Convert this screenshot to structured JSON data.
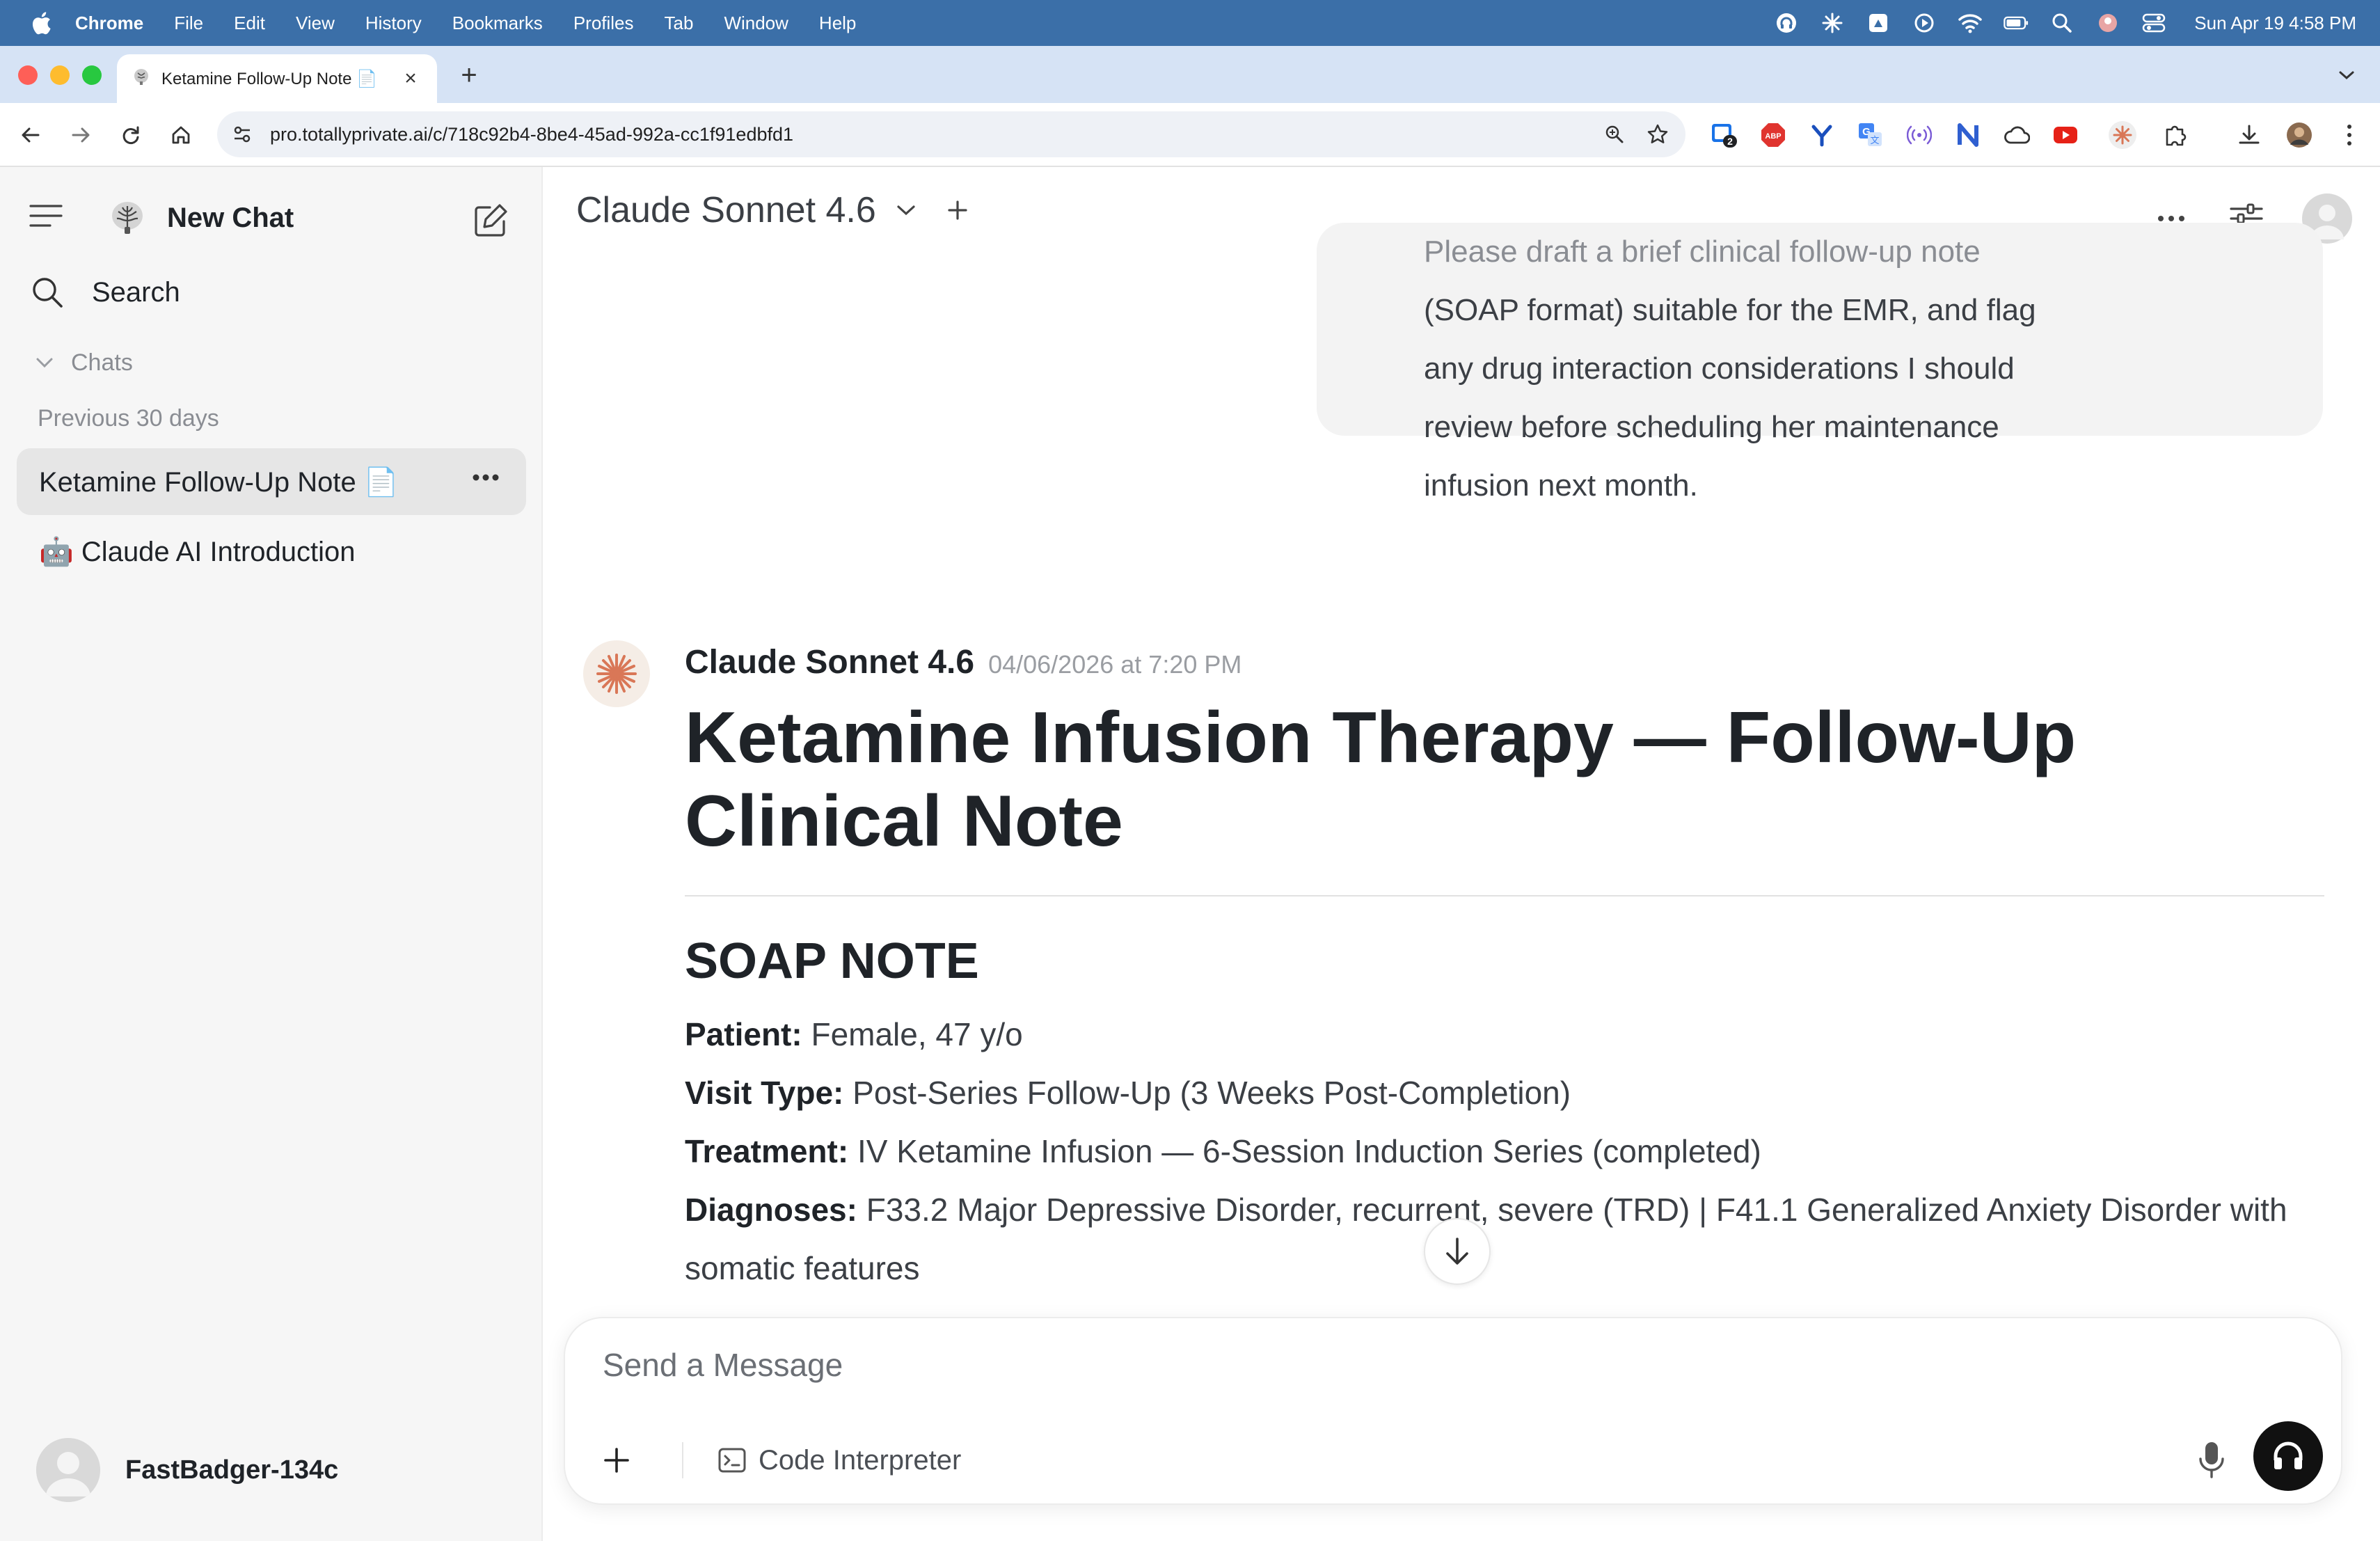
{
  "menubar": {
    "app": "Chrome",
    "items": [
      "File",
      "Edit",
      "View",
      "History",
      "Bookmarks",
      "Profiles",
      "Tab",
      "Window",
      "Help"
    ],
    "clock": "Sun Apr 19  4:58 PM",
    "bg_color": "#3b6fa8"
  },
  "browser": {
    "tab_title": "Ketamine Follow-Up Note 📄",
    "url": "pro.totallyprivate.ai/c/718c92b4-8be4-45ad-992a-cc1f91edbfd1",
    "extension_badge": "2"
  },
  "sidebar": {
    "new_chat_label": "New Chat",
    "search_label": "Search",
    "chats_section_label": "Chats",
    "period_label": "Previous 30 days",
    "chats": [
      {
        "label": "Ketamine Follow-Up Note 📄",
        "active": true
      },
      {
        "label": "🤖 Claude AI Introduction",
        "active": false
      }
    ],
    "user_name": "FastBadger-134c"
  },
  "header": {
    "model_name": "Claude Sonnet 4.6"
  },
  "conversation": {
    "user_message_lines": [
      "Please draft a brief clinical follow-up note",
      "(SOAP format) suitable for the EMR, and flag",
      "any drug interaction considerations I should",
      "review before scheduling her maintenance",
      "infusion next month."
    ],
    "assistant": {
      "name": "Claude Sonnet 4.6",
      "timestamp": "04/06/2026 at 7:20 PM",
      "title": "Ketamine Infusion Therapy — Follow-Up Clinical Note",
      "section_heading": "SOAP NOTE",
      "fields": [
        {
          "label": "Patient:",
          "value": "Female, 47 y/o"
        },
        {
          "label": "Visit Type:",
          "value": "Post-Series Follow-Up (3 Weeks Post-Completion)"
        },
        {
          "label": "Treatment:",
          "value": "IV Ketamine Infusion — 6-Session Induction Series (completed)"
        },
        {
          "label": "Diagnoses:",
          "value": "F33.2 Major Depressive Disorder, recurrent, severe (TRD) | F41.1 Generalized Anxiety Disorder with somatic features"
        }
      ]
    }
  },
  "composer": {
    "placeholder": "Send a Message",
    "code_interpreter_label": "Code Interpreter"
  },
  "colors": {
    "sidebar_bg": "#f6f6f6",
    "active_chat_bg": "#e6e6e6",
    "accent_claude": "#d97757"
  }
}
